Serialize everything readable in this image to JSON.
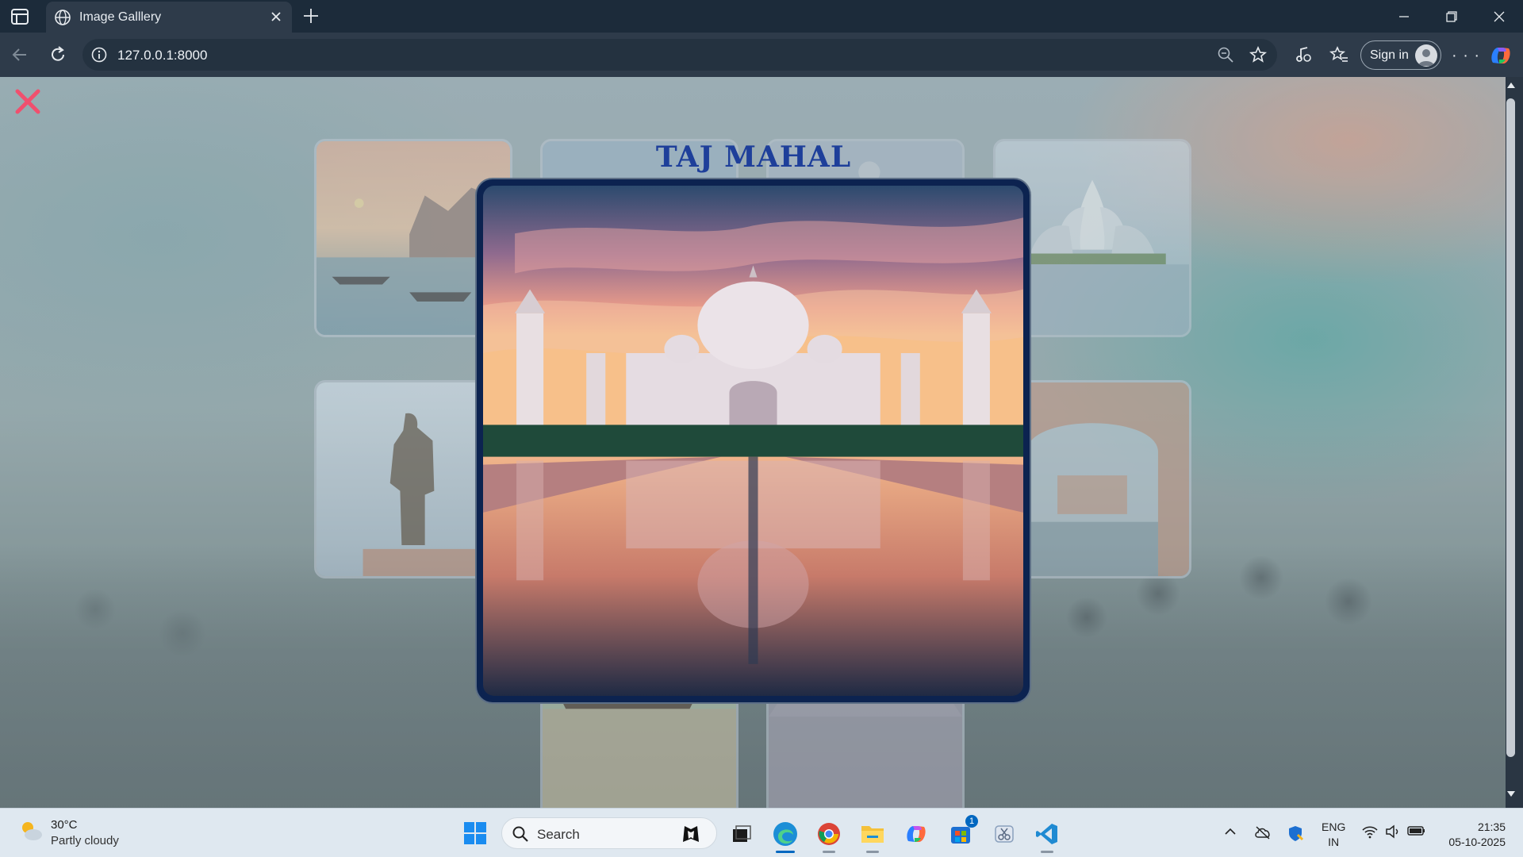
{
  "browser": {
    "tab_title": "Image Galllery",
    "url": "127.0.0.1:8000",
    "signin_label": "Sign in"
  },
  "gallery": {
    "lightbox_title": "TAJ MAHAL",
    "accent_close_color": "#f0506e",
    "title_color": "#1e3f9a",
    "thumbnails": [
      {
        "subject": "ghats-river-boats"
      },
      {
        "subject": "taj-mahal-top"
      },
      {
        "subject": "taj-mahal-top-2"
      },
      {
        "subject": "lotus-temple"
      },
      {
        "subject": "statue-of-unity"
      },
      {
        "subject": "hawa-mahal"
      },
      {
        "subject": "kerala-houseboat"
      },
      {
        "subject": "taj-mahal-reflection"
      }
    ]
  },
  "taskbar": {
    "weather_temp": "30°C",
    "weather_desc": "Partly cloudy",
    "search_label": "Search",
    "lang_line1": "ENG",
    "lang_line2": "IN",
    "time": "21:35",
    "date": "05-10-2025",
    "store_badge": "1",
    "apps": [
      "windows-start",
      "task-view",
      "edge",
      "chrome",
      "file-explorer",
      "copilot",
      "microsoft-store",
      "snipping-tool",
      "vscode"
    ]
  }
}
